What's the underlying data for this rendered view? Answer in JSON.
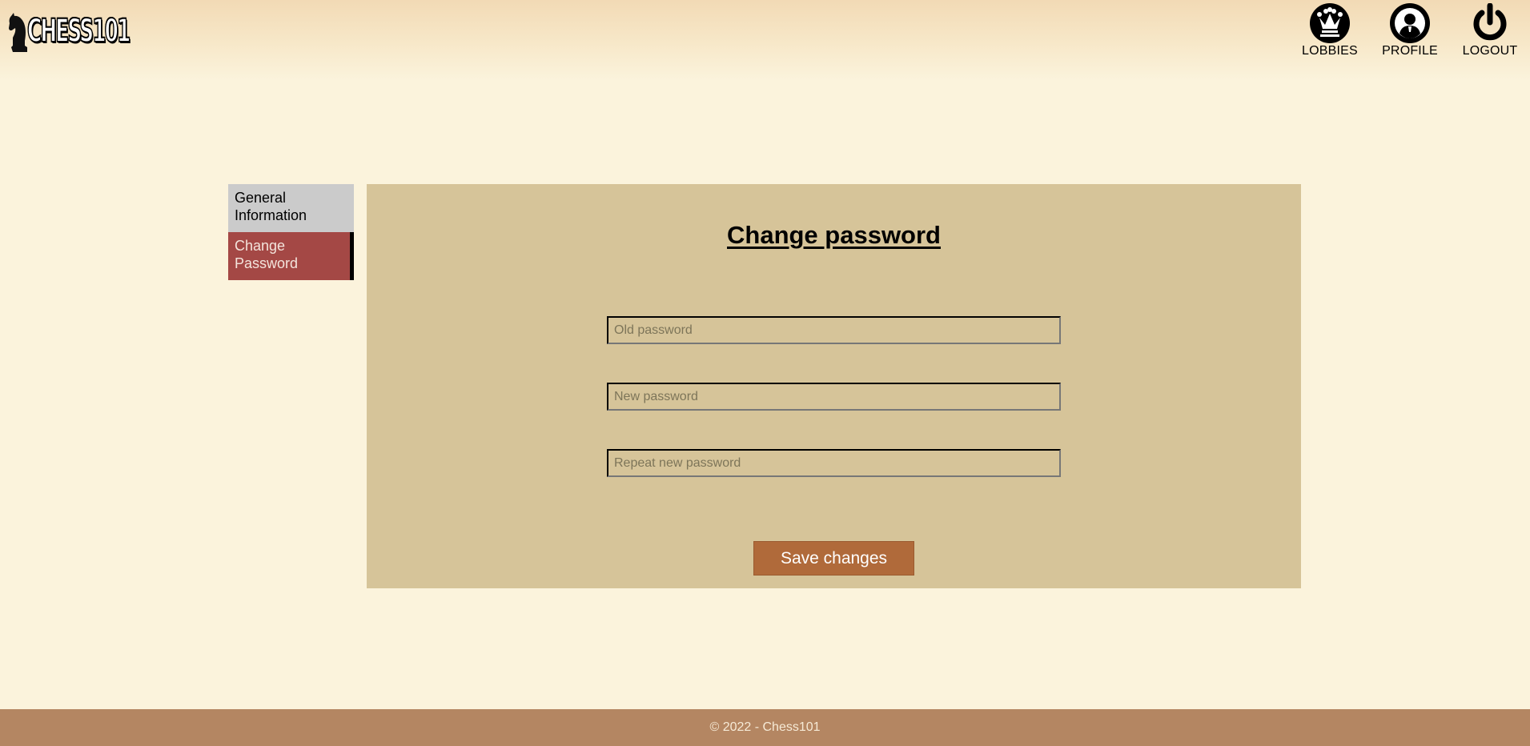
{
  "header": {
    "logo_text": "CHESS101",
    "nav": [
      {
        "label": "LOBBIES",
        "icon": "crown-icon"
      },
      {
        "label": "PROFILE",
        "icon": "user-icon"
      },
      {
        "label": "LOGOUT",
        "icon": "power-icon"
      }
    ]
  },
  "sidebar": {
    "items": [
      {
        "label": "General Information",
        "active": false
      },
      {
        "label": "Change Password",
        "active": true
      }
    ]
  },
  "form": {
    "title": "Change password",
    "old_password": {
      "value": "",
      "placeholder": "Old password"
    },
    "new_password": {
      "value": "",
      "placeholder": "New password"
    },
    "repeat_password": {
      "value": "",
      "placeholder": "Repeat new password"
    },
    "save_label": "Save changes"
  },
  "footer": {
    "text": "© 2022 - Chess101"
  },
  "colors": {
    "background": "#fbf3dc",
    "panel": "#d6c499",
    "active_tab": "#a44845",
    "inactive_tab": "#cbcbcb",
    "save_button": "#b06a3a",
    "footer": "#b48662"
  }
}
